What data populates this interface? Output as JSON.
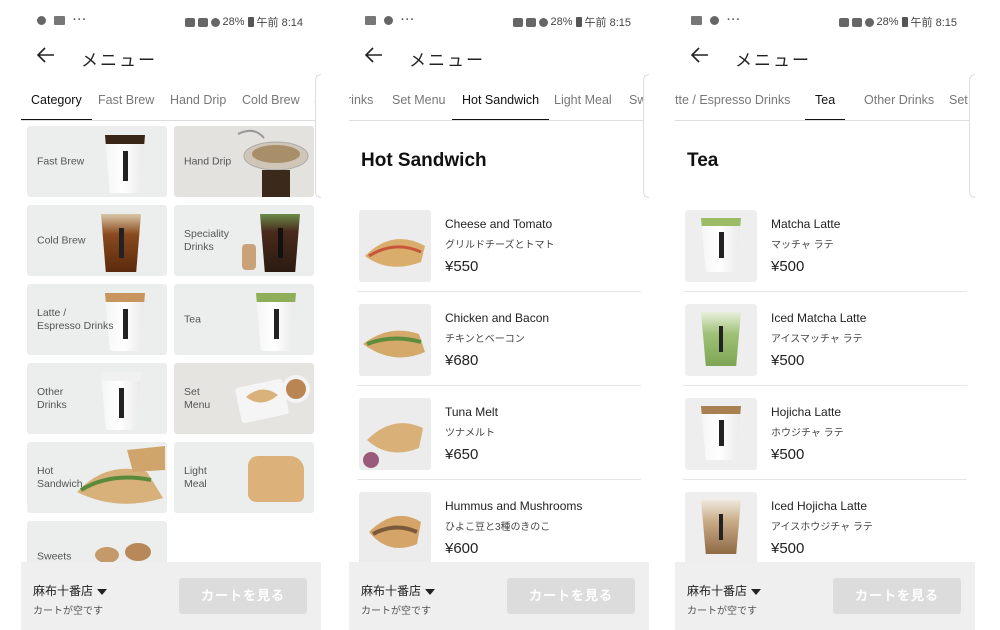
{
  "screens": [
    {
      "status": {
        "battery": "28%",
        "time": "午前 8:14"
      },
      "header": {
        "title": "メニュー"
      },
      "tabs": [
        "Category",
        "Fast Brew",
        "Hand Drip",
        "Cold Brew",
        "S"
      ],
      "active_tab": 0,
      "categories": [
        {
          "label": "Fast Brew",
          "icon": "hot-coffee-cup-image"
        },
        {
          "label": "Hand Drip",
          "icon": "hand-drip-image"
        },
        {
          "label": "Cold Brew",
          "icon": "iced-coffee-image"
        },
        {
          "label": "Speciality\nDrinks",
          "icon": "speciality-drink-image"
        },
        {
          "label": "Latte /\nEspresso Drinks",
          "icon": "latte-cup-image"
        },
        {
          "label": "Tea",
          "icon": "matcha-cup-image"
        },
        {
          "label": "Other\nDrinks",
          "icon": "other-drink-image"
        },
        {
          "label": "Set\nMenu",
          "icon": "set-menu-image"
        },
        {
          "label": "Hot\nSandwich",
          "icon": "sandwich-image"
        },
        {
          "label": "Light\nMeal",
          "icon": "scone-image"
        },
        {
          "label": "Sweets",
          "icon": "cookies-image"
        }
      ],
      "footer": {
        "store": "麻布十番店",
        "cart_status": "カートが空です",
        "cart_button": "カートを見る"
      }
    },
    {
      "status": {
        "battery": "28%",
        "time": "午前 8:15"
      },
      "header": {
        "title": "メニュー"
      },
      "tabs": [
        "rinks",
        "Set Menu",
        "Hot Sandwich",
        "Light Meal",
        "Swe"
      ],
      "active_tab": 2,
      "section_title": "Hot Sandwich",
      "items": [
        {
          "name": "Cheese and Tomato",
          "name_jp": "グリルドチーズとトマト",
          "price": "¥550"
        },
        {
          "name": "Chicken and Bacon",
          "name_jp": "チキンとベーコン",
          "price": "¥680"
        },
        {
          "name": "Tuna Melt",
          "name_jp": "ツナメルト",
          "price": "¥650"
        },
        {
          "name": "Hummus and Mushrooms",
          "name_jp": "ひよこ豆と3種のきのこ",
          "price": "¥600"
        }
      ],
      "footer": {
        "store": "麻布十番店",
        "cart_status": "カートが空です",
        "cart_button": "カートを見る"
      }
    },
    {
      "status": {
        "battery": "28%",
        "time": "午前 8:15"
      },
      "header": {
        "title": "メニュー"
      },
      "tabs": [
        "tte / Espresso Drinks",
        "Tea",
        "Other Drinks",
        "Set M"
      ],
      "active_tab": 1,
      "section_title": "Tea",
      "items": [
        {
          "name": "Matcha Latte",
          "name_jp": "マッチャ ラテ",
          "price": "¥500"
        },
        {
          "name": "Iced Matcha Latte",
          "name_jp": "アイスマッチャ ラテ",
          "price": "¥500"
        },
        {
          "name": "Hojicha Latte",
          "name_jp": "ホウジチャ ラテ",
          "price": "¥500"
        },
        {
          "name": "Iced Hojicha Latte",
          "name_jp": "アイスホウジチャ ラテ",
          "price": "¥500"
        }
      ],
      "footer": {
        "store": "麻布十番店",
        "cart_status": "カートが空です",
        "cart_button": "カートを見る"
      }
    }
  ],
  "colors": {
    "accent": "#111111",
    "tab_inactive": "#777777",
    "card_bg": "#eceded",
    "footer_bg": "#efefef",
    "cart_button_disabled": "#dcdcdc"
  }
}
